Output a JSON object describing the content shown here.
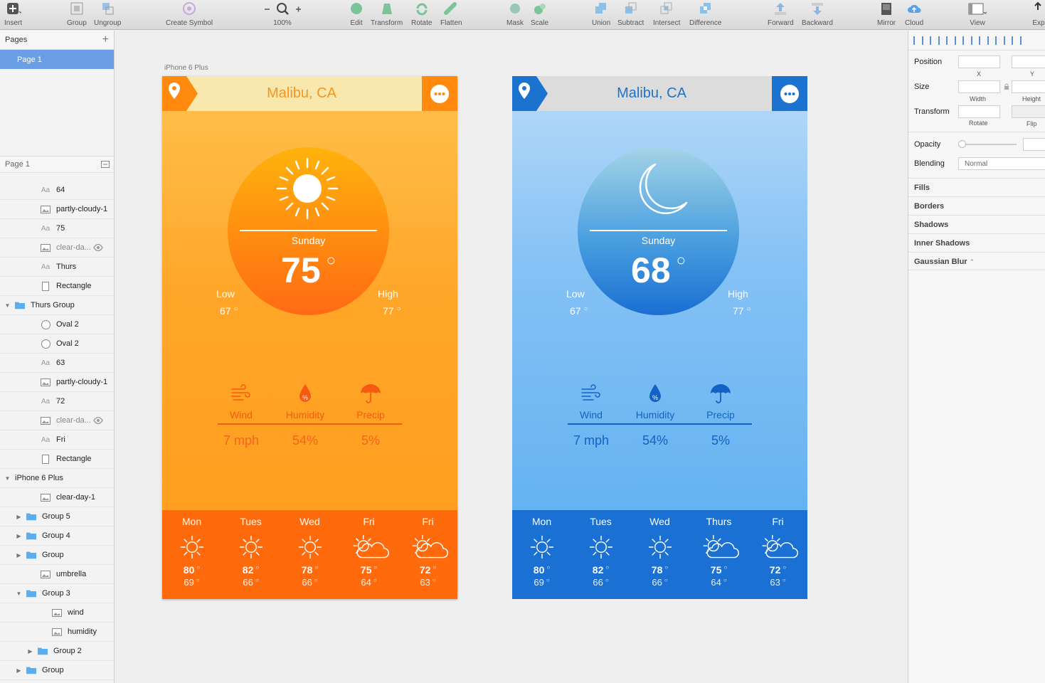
{
  "toolbar": {
    "items": [
      {
        "label": "Insert"
      },
      {
        "label": "Group"
      },
      {
        "label": "Ungroup"
      },
      {
        "label": "Create Symbol"
      },
      {
        "label": "100%"
      },
      {
        "label": "Edit"
      },
      {
        "label": "Transform"
      },
      {
        "label": "Rotate"
      },
      {
        "label": "Flatten"
      },
      {
        "label": "Mask"
      },
      {
        "label": "Scale"
      },
      {
        "label": "Union"
      },
      {
        "label": "Subtract"
      },
      {
        "label": "Intersect"
      },
      {
        "label": "Difference"
      },
      {
        "label": "Forward"
      },
      {
        "label": "Backward"
      },
      {
        "label": "Mirror"
      },
      {
        "label": "Cloud"
      },
      {
        "label": "View"
      },
      {
        "label": "Exp"
      }
    ]
  },
  "left_panel": {
    "pages_title": "Pages",
    "page_selected": "Page 1",
    "layers_title": "Page 1",
    "layers": [
      {
        "type": "text",
        "label": "64",
        "indent": 1
      },
      {
        "type": "image",
        "label": "partly-cloudy-1",
        "indent": 1
      },
      {
        "type": "text",
        "label": "75",
        "indent": 1
      },
      {
        "type": "image",
        "label": "clear-da...",
        "indent": 1,
        "hidden": true
      },
      {
        "type": "text",
        "label": "Thurs",
        "indent": 1
      },
      {
        "type": "rect",
        "label": "Rectangle",
        "indent": 1
      },
      {
        "type": "folder",
        "label": "Thurs Group",
        "indent": 0,
        "open": true
      },
      {
        "type": "oval",
        "label": "Oval 2",
        "indent": 1
      },
      {
        "type": "oval",
        "label": "Oval 2",
        "indent": 1
      },
      {
        "type": "text",
        "label": "63",
        "indent": 1
      },
      {
        "type": "image",
        "label": "partly-cloudy-1",
        "indent": 1
      },
      {
        "type": "text",
        "label": "72",
        "indent": 1
      },
      {
        "type": "image",
        "label": "clear-da...",
        "indent": 1,
        "hidden": true
      },
      {
        "type": "text",
        "label": "Fri",
        "indent": 1
      },
      {
        "type": "rect",
        "label": "Rectangle",
        "indent": 1
      },
      {
        "type": "artboard",
        "label": "iPhone 6 Plus",
        "indent": 0,
        "open": true
      },
      {
        "type": "image",
        "label": "clear-day-1",
        "indent": 1
      },
      {
        "type": "folder",
        "label": "Group 5",
        "indent": 1,
        "open": false
      },
      {
        "type": "folder",
        "label": "Group 4",
        "indent": 1,
        "open": false
      },
      {
        "type": "folder",
        "label": "Group",
        "indent": 1,
        "open": false
      },
      {
        "type": "image",
        "label": "umbrella",
        "indent": 1
      },
      {
        "type": "folder",
        "label": "Group 3",
        "indent": 1,
        "open": true
      },
      {
        "type": "image",
        "label": "wind",
        "indent": 2
      },
      {
        "type": "image",
        "label": "humidity",
        "indent": 2
      },
      {
        "type": "folder",
        "label": "Group 2",
        "indent": 2,
        "open": false
      },
      {
        "type": "folder",
        "label": "Group",
        "indent": 1,
        "open": false
      }
    ]
  },
  "canvas": {
    "artboard_label": "iPhone 6 Plus",
    "phones": [
      {
        "theme": "orange",
        "accent": "#f55a13",
        "city": "Malibu, CA",
        "day": "Sunday",
        "temp": "75",
        "deg": "°",
        "low_label": "Low",
        "low": "67",
        "high_label": "High",
        "high": "77",
        "stats": [
          {
            "label": "Wind",
            "value": "7 mph"
          },
          {
            "label": "Humidity",
            "value": "54%"
          },
          {
            "label": "Precip",
            "value": "5%"
          }
        ],
        "forecast": [
          {
            "day": "Mon",
            "high": "80",
            "low": "69",
            "icon": "sun"
          },
          {
            "day": "Tues",
            "high": "82",
            "low": "66",
            "icon": "sun"
          },
          {
            "day": "Wed",
            "high": "78",
            "low": "66",
            "icon": "sun"
          },
          {
            "day": "Fri",
            "high": "75",
            "low": "64",
            "icon": "partly-cloudy"
          },
          {
            "day": "Fri",
            "high": "72",
            "low": "63",
            "icon": "partly-cloudy"
          }
        ]
      },
      {
        "theme": "blue",
        "accent": "#1262c3",
        "city": "Malibu, CA",
        "day": "Sunday",
        "temp": "68",
        "deg": "°",
        "low_label": "Low",
        "low": "67",
        "high_label": "High",
        "high": "77",
        "stats": [
          {
            "label": "Wind",
            "value": "7 mph"
          },
          {
            "label": "Humidity",
            "value": "54%"
          },
          {
            "label": "Precip",
            "value": "5%"
          }
        ],
        "forecast": [
          {
            "day": "Mon",
            "high": "80",
            "low": "69",
            "icon": "sun"
          },
          {
            "day": "Tues",
            "high": "82",
            "low": "66",
            "icon": "sun"
          },
          {
            "day": "Wed",
            "high": "78",
            "low": "66",
            "icon": "sun"
          },
          {
            "day": "Thurs",
            "high": "75",
            "low": "64",
            "icon": "partly-cloudy"
          },
          {
            "day": "Fri",
            "high": "72",
            "low": "63",
            "icon": "partly-cloudy"
          }
        ]
      }
    ]
  },
  "inspector": {
    "position_label": "Position",
    "x_label": "X",
    "y_label": "Y",
    "size_label": "Size",
    "width_label": "Width",
    "height_label": "Height",
    "transform_label": "Transform",
    "rotate_label": "Rotate",
    "flip_label": "Flip",
    "opacity_label": "Opacity",
    "blending_label": "Blending",
    "blending_value": "Normal",
    "sections": [
      "Fills",
      "Borders",
      "Shadows",
      "Inner Shadows",
      "Gaussian Blur"
    ]
  }
}
